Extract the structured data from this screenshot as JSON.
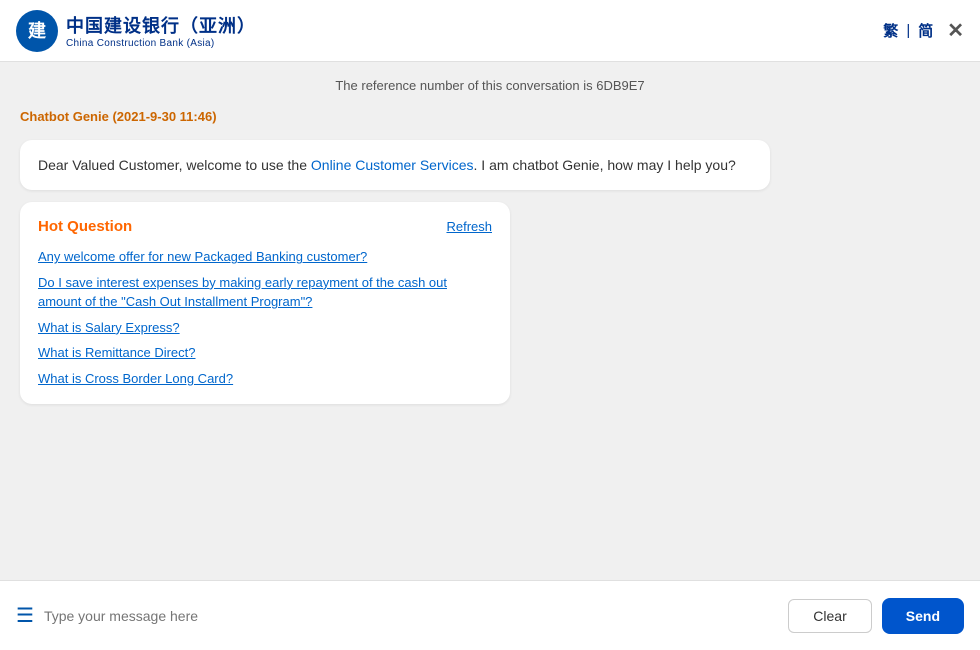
{
  "header": {
    "logo_cn": "中国建设银行（亚洲）",
    "logo_en": "China Construction Bank (Asia)",
    "lang_traditional": "繁",
    "lang_simplified": "简",
    "divider": "|",
    "close_label": "✕"
  },
  "chat": {
    "reference_text": "The reference number of this conversation is 6DB9E7",
    "chatbot_label": "Chatbot Genie (2021-9-30 11:46)",
    "welcome_message_part1": "Dear Valued Customer, welcome to use the ",
    "welcome_message_link": "Online Customer Services",
    "welcome_message_part2": ". I am chatbot Genie, how may I help you?"
  },
  "hot_questions": {
    "title": "Hot Question",
    "refresh_label": "Refresh",
    "items": [
      "Any welcome offer for new Packaged Banking customer?",
      "Do I save interest expenses by making early repayment of the cash out amount of the \"Cash Out Installment Program\"?",
      "What is Salary Express?",
      "What is Remittance Direct?",
      "What is Cross Border Long Card?"
    ]
  },
  "input": {
    "placeholder": "Type your message here",
    "clear_label": "Clear",
    "send_label": "Send"
  }
}
